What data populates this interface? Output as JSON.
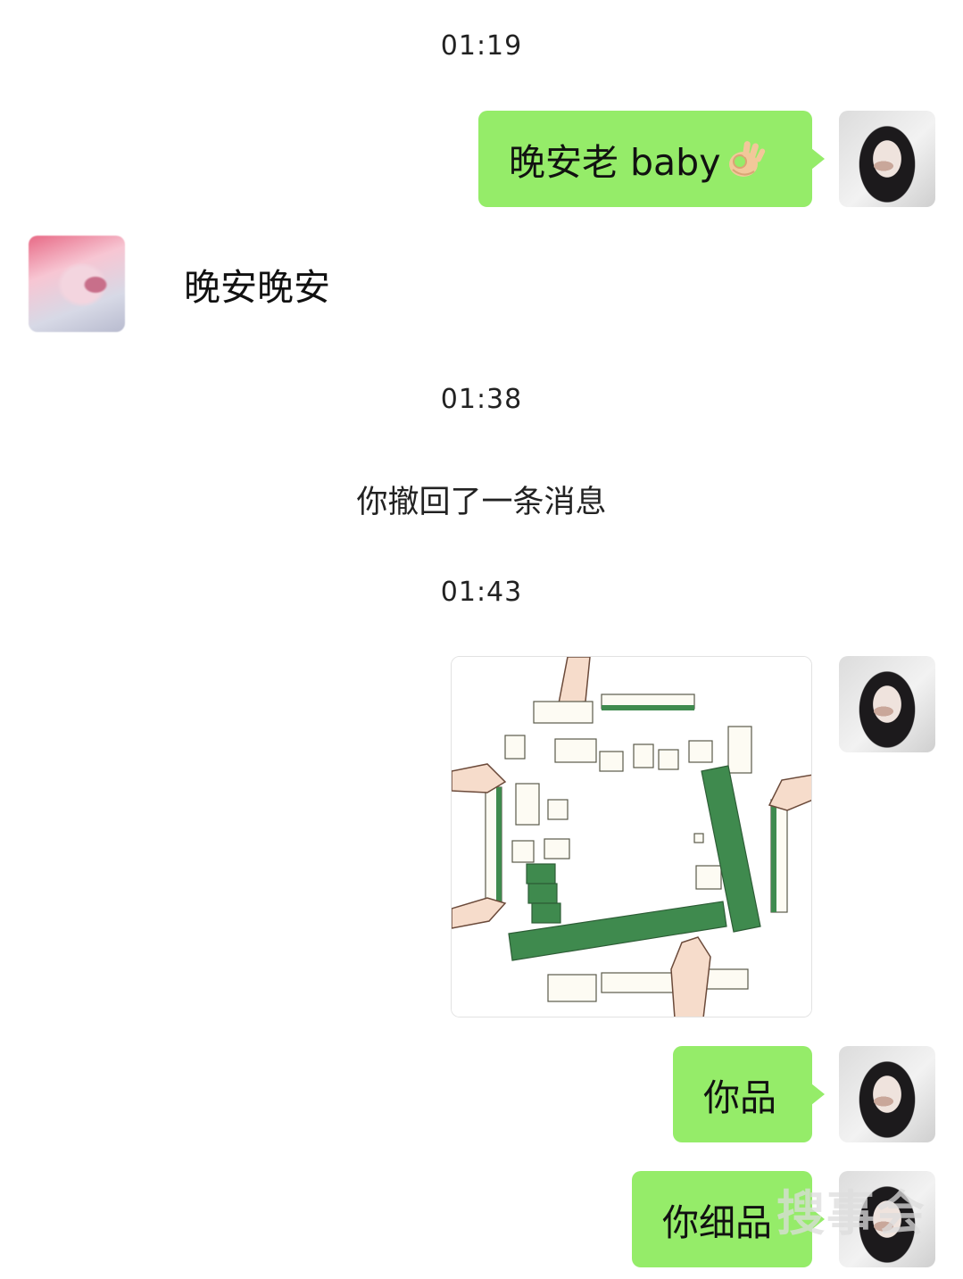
{
  "messages": {
    "time1": "01:19",
    "me_msg1": "晚安老 baby",
    "me_msg1_emoji": "ok-hand-icon",
    "other_msg1": "晚安晚安",
    "time2": "01:38",
    "system_recall": "你撤回了一条消息",
    "time3": "01:43",
    "me_image": "mahjong-table-illustration",
    "me_msg2": "你品",
    "me_msg3": "你细品"
  },
  "watermark": "搜事会",
  "colors": {
    "my_bubble": "#95ec69",
    "background": "#ffffff",
    "tile_green": "#3f8a4e"
  }
}
